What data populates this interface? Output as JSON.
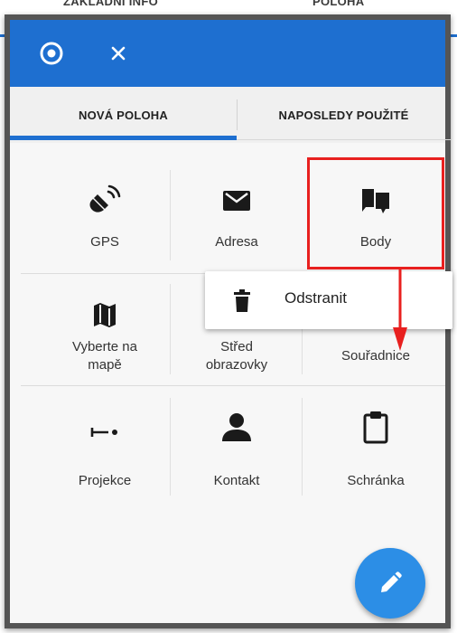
{
  "background": {
    "tab_left": "ZÁKLADNÍ INFO",
    "tab_right": "POLOHA"
  },
  "appbar": {
    "target_icon": "target-icon",
    "close_icon": "close-icon",
    "color": "#1e6fd0"
  },
  "tabs": [
    {
      "label": "NOVÁ POLOHA",
      "active": true
    },
    {
      "label": "NAPOSLEDY POUŽITÉ",
      "active": false
    }
  ],
  "grid": {
    "items": [
      {
        "label": "GPS",
        "icon": "gps-icon"
      },
      {
        "label": "Adresa",
        "icon": "envelope-icon"
      },
      {
        "label": "Body",
        "icon": "points-icon"
      },
      {
        "label_line1": "Vyberte na",
        "label_line2": "mapě",
        "icon": "map-icon"
      },
      {
        "label_line1": "Střed",
        "label_line2": "obrazovky",
        "icon": "center-icon"
      },
      {
        "label": "Souřadnice",
        "icon": "coordinates-icon"
      },
      {
        "label": "Projekce",
        "icon": "projection-icon"
      },
      {
        "label": "Kontakt",
        "icon": "contact-icon"
      },
      {
        "label": "Schránka",
        "icon": "clipboard-icon"
      }
    ]
  },
  "popup": {
    "label": "Odstranit",
    "icon": "trash-icon"
  },
  "annotation": {
    "highlight_color": "#e8201f"
  },
  "fab": {
    "icon": "pencil-icon",
    "color": "#2c8ee6"
  }
}
